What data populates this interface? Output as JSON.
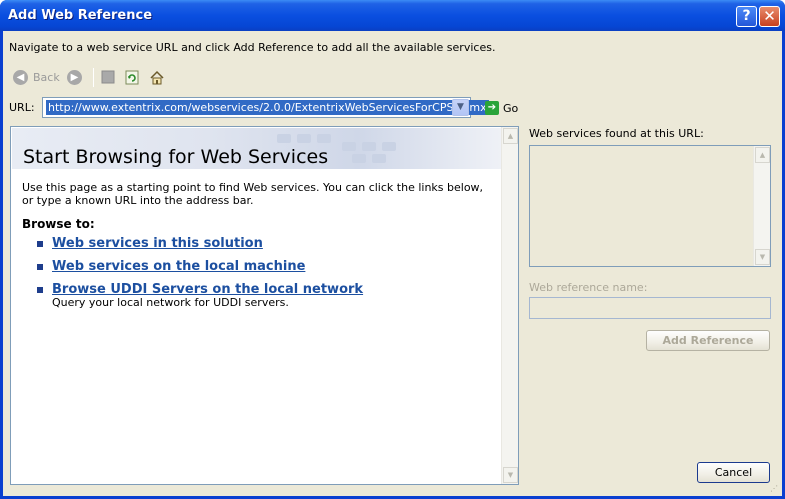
{
  "window": {
    "title": "Add Web Reference",
    "help_glyph": "?",
    "close_glyph": "✕"
  },
  "instruction": "Navigate to a web service URL and click Add Reference to add all the available services.",
  "toolbar": {
    "back_label": "Back",
    "icons": [
      "back-icon",
      "forward-icon",
      "stop-icon",
      "refresh-icon",
      "home-icon"
    ]
  },
  "url_bar": {
    "label": "URL:",
    "value": "http://www.extentrix.com/webservices/2.0.0/ExtentrixWebServicesForCPS.asmx",
    "go_label": "Go"
  },
  "browser": {
    "heading": "Start Browsing for Web Services",
    "intro": "Use this page as a starting point to find Web services. You can click the links below, or type a known URL into the address bar.",
    "browse_to_label": "Browse to:",
    "links": [
      "Web services in this solution",
      "Web services on the local machine",
      "Browse UDDI Servers on the local network"
    ],
    "uddi_description": "Query your local network for UDDI servers."
  },
  "right_panel": {
    "found_label": "Web services found at this URL:",
    "reference_name_label": "Web reference name:",
    "reference_name_value": "",
    "add_reference_label": "Add Reference"
  },
  "buttons": {
    "cancel_label": "Cancel"
  },
  "colors": {
    "title_bar": "#0a4fe0",
    "dialog_bg": "#ece9d8",
    "link": "#1c4fa0",
    "selection": "#316ac5"
  }
}
